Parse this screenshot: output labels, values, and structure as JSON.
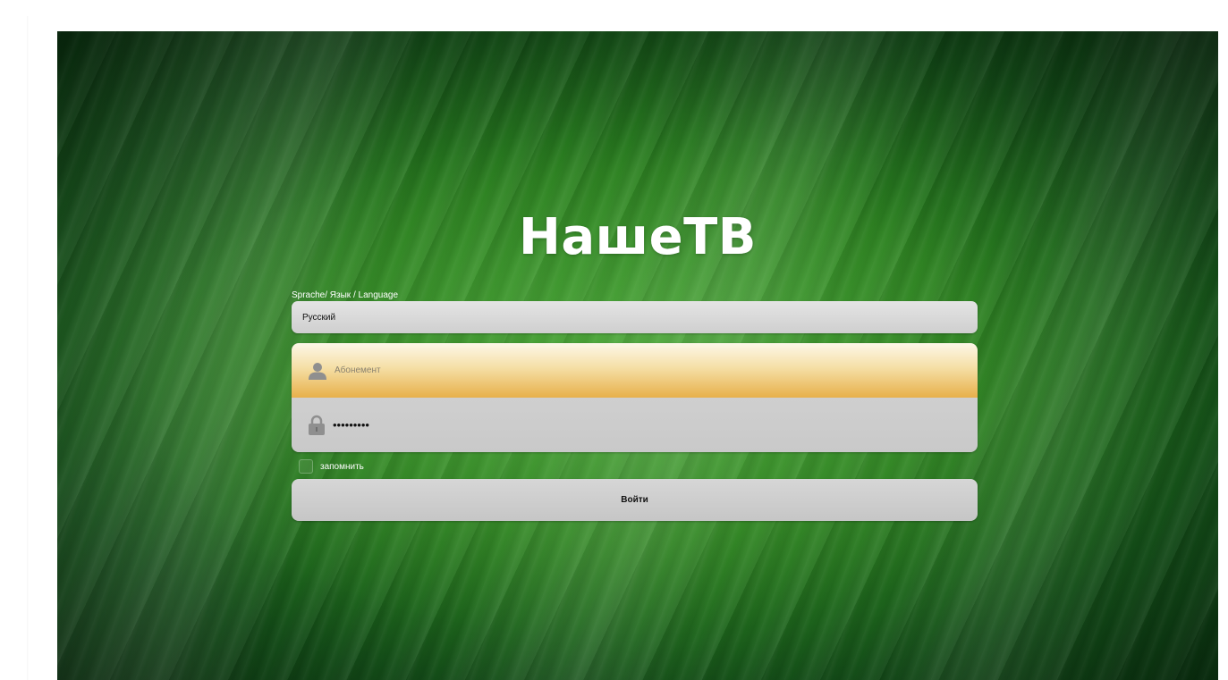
{
  "app": {
    "title": "НашеТВ"
  },
  "language": {
    "label": "Sprache/ Язык / Language",
    "selected": "Русский"
  },
  "login": {
    "username_placeholder": "Абонемент",
    "username_value": "",
    "password_mask": "•••••••••",
    "remember_label": "запомнить",
    "remember_checked": false,
    "submit_label": "Войти"
  },
  "colors": {
    "accent_field": "#e7b04a",
    "background": "#2a7f1f",
    "field_gray": "#cfcfcf"
  },
  "icons": {
    "username": "user-icon",
    "password": "lock-icon"
  }
}
